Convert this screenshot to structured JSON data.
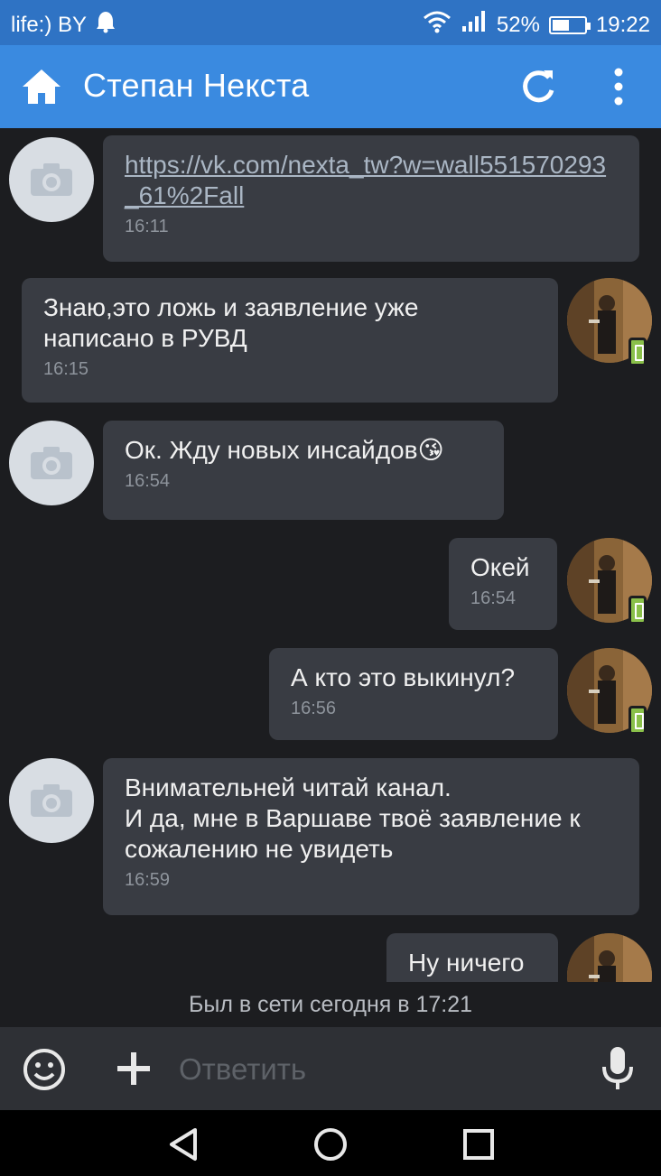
{
  "status_bar": {
    "carrier": "life:) BY",
    "battery": "52%",
    "battery_level": 0.52,
    "time": "19:22"
  },
  "header": {
    "title": "Степан Некста",
    "icons": [
      "home-icon",
      "refresh-icon",
      "more-vert-icon"
    ]
  },
  "messages": [
    {
      "side": "in",
      "link": "https://vk.com/nexta_tw?w=wall551570293_61%2Fall",
      "time": "16:11"
    },
    {
      "side": "out",
      "text": "Знаю,это ложь и заявление уже\nнаписано в РУВД",
      "time": "16:15"
    },
    {
      "side": "in",
      "text": "Ок. Жду новых инсайдов",
      "emoji": "😘",
      "time": "16:54"
    },
    {
      "side": "out",
      "text": "Окей",
      "time": "16:54"
    },
    {
      "side": "out",
      "text": "А кто это выкинул?",
      "time": "16:56"
    },
    {
      "side": "in",
      "text": "Внимательней читай канал.\nИ да, мне в Варшаве твоё заявление к\nсожалению не увидеть",
      "time": "16:59"
    },
    {
      "side": "out",
      "text": "Ну ничего",
      "time": ""
    }
  ],
  "last_seen": "Был в сети сегодня в 17:21",
  "composer": {
    "placeholder": "Ответить",
    "icons": [
      "emoji-icon",
      "plus-icon",
      "mic-icon"
    ]
  },
  "nav": {
    "icons": [
      "back-icon",
      "home-circle-icon",
      "recents-icon"
    ]
  },
  "colors": {
    "status_bar": "#2f73c4",
    "app_bar": "#3a8ae0",
    "background": "#1c1d20",
    "bubble": "#393c43",
    "online_badge": "#8ac04a"
  }
}
